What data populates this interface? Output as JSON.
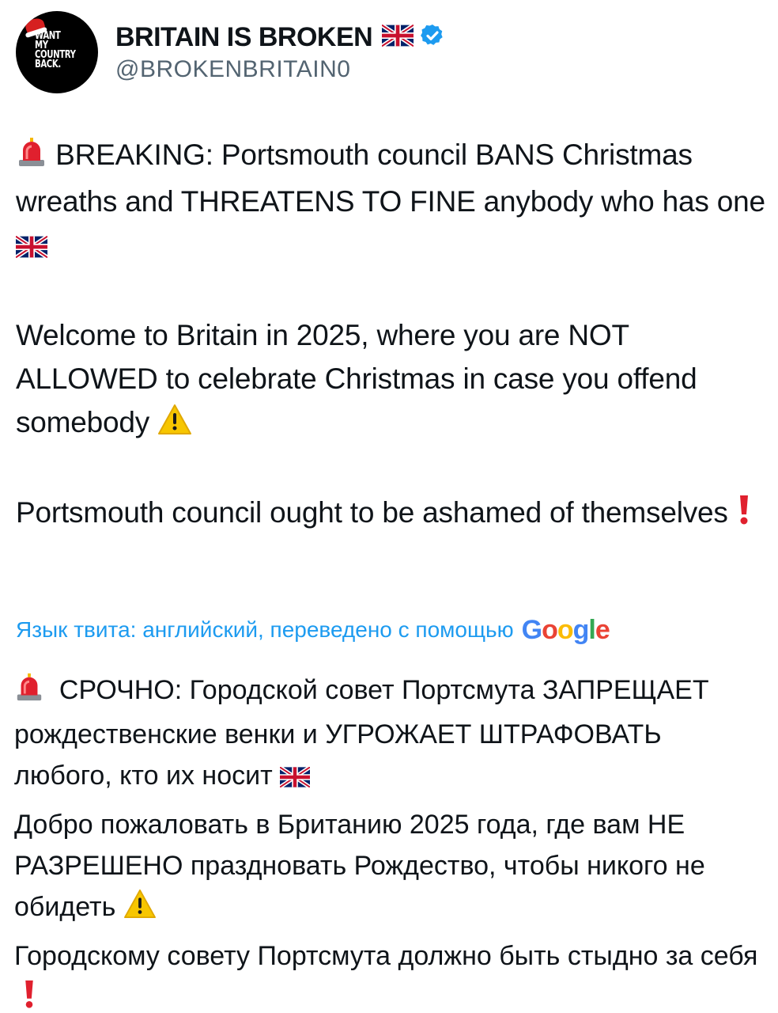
{
  "author": {
    "display_name": "BRITAIN IS BROKEN",
    "handle": "@BROKENBRITAIN0",
    "avatar_text": "WANT\nMY\nCOUNTRY\nBACK.",
    "verified_color": "#1d9bf0"
  },
  "tweet": {
    "paragraphs_en": [
      "BREAKING: Portsmouth council BANS Christmas wreaths and THREATENS TO FINE anybody who has one",
      "Welcome to Britain in 2025, where you are NOT ALLOWED to celebrate Christmas in case you offend somebody",
      "Portsmouth council ought to be ashamed of themselves"
    ],
    "translation_note": "Язык твита: английский, переведено с помощью",
    "translation_provider": "Google",
    "paragraphs_ru": [
      "СРОЧНО: Городской совет Портсмута ЗАПРЕЩАЕТ рождественские венки и УГРОЖАЕТ ШТРАФОВАТЬ любого, кто их носит",
      "Добро пожаловать в Британию 2025 года, где вам НЕ РАЗРЕШЕНО праздновать Рождество, чтобы никого не обидеть",
      "Городскому совету Портсмута должно быть стыдно за себя"
    ]
  },
  "icons": [
    "siren-emoji-icon",
    "uk-flag-icon",
    "warning-emoji-icon",
    "exclamation-emoji-icon",
    "verified-badge-icon"
  ],
  "colors": {
    "link": "#1d9bf0",
    "text": "#0f1419",
    "secondary": "#536471",
    "google_blue": "#4285F4",
    "google_red": "#EA4335",
    "google_yellow": "#FBBC05",
    "google_green": "#34A853"
  }
}
